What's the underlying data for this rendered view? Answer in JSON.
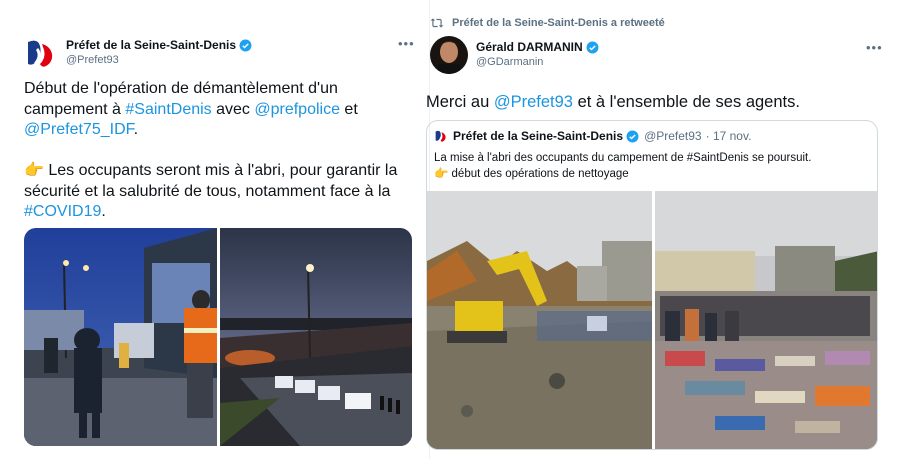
{
  "left_tweet": {
    "author_name": "Préfet de la Seine-Saint-Denis",
    "author_handle": "@Prefet93",
    "more": "•••",
    "line1": "Début de l'opération de démantèlement d'un",
    "line2_pre": "campement à ",
    "hashtag_saintdenis": "#SaintDenis",
    "line2_mid": " avec ",
    "mention_prefpolice": "@prefpolice",
    "line2_post": " et",
    "mention_prefet75": "@Prefet75_IDF",
    "line3_post": ".",
    "emoji_point": "👉",
    "line4": " Les occupants seront mis à l'abri, pour garantir la",
    "line5": "sécurité et la salubrité de tous, notamment face à la",
    "hashtag_covid": "#COVID19",
    "line6_post": "."
  },
  "right_tweet": {
    "retweet_label": "Préfet de la Seine-Saint-Denis a retweeté",
    "author_name": "Gérald DARMANIN",
    "author_handle": "@GDarmanin",
    "more": "•••",
    "text_pre": "Merci au ",
    "mention_prefet93": "@Prefet93",
    "text_post": " et à l'ensemble de ses agents.",
    "quote": {
      "author_name": "Préfet de la Seine-Saint-Denis",
      "author_handle": "@Prefet93",
      "date": "· 17 nov.",
      "line1": "La mise à l'abri des occupants du campement de #SaintDenis se poursuit.",
      "emoji_point": "👉",
      "line2": " début des opérations de nettoyage"
    }
  },
  "colors": {
    "link": "#1b95e0",
    "verified": "#1da1f2",
    "secondary_text": "#5b7083"
  },
  "icons": [
    "marianne-logo",
    "verified-badge-icon",
    "more-options-icon",
    "retweet-icon"
  ]
}
